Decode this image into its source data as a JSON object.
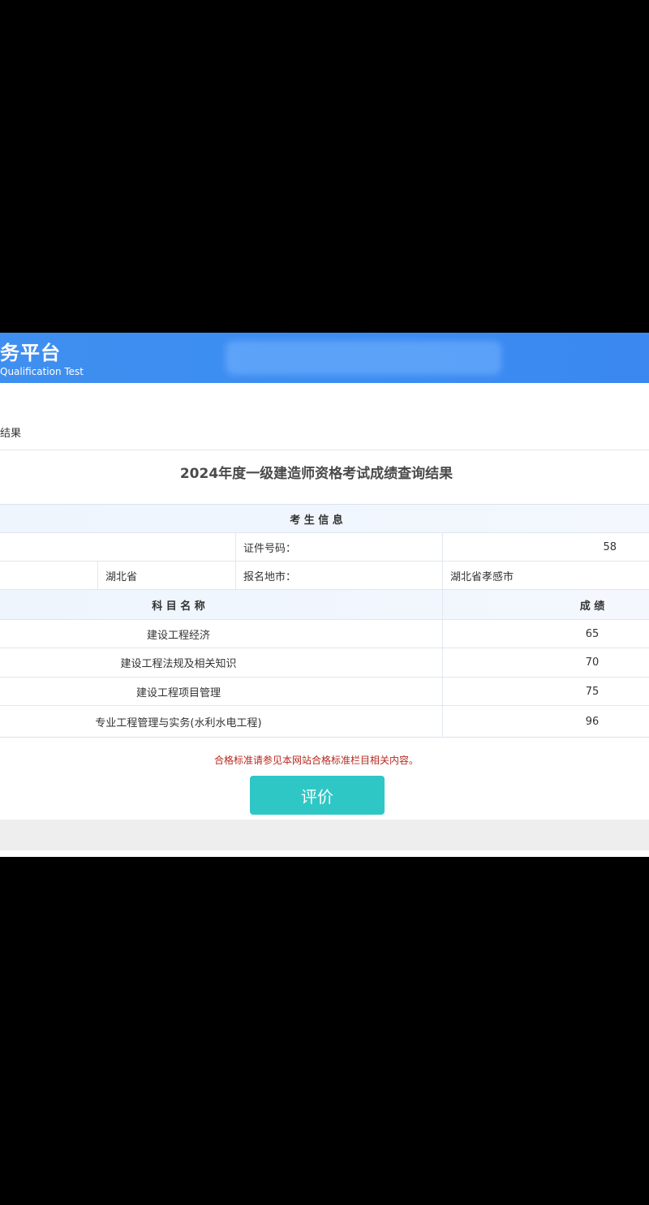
{
  "header": {
    "title": "务平台",
    "subtitle": "Qualification Test"
  },
  "breadcrumb": "结果",
  "result_title": "2024年度一级建造师资格考试成绩查询结果",
  "candidate_info": {
    "section_label": "考 生 信 息",
    "id_label": "证件号码：",
    "id_value": "58",
    "province_value": "湖北省",
    "city_label": "报名地市：",
    "city_value": "湖北省孝感市"
  },
  "scores_table": {
    "columns": [
      "科 目 名 称",
      "成 绩"
    ],
    "rows": [
      {
        "subject": "建设工程经济",
        "score": "65"
      },
      {
        "subject": "建设工程法规及相关知识",
        "score": "70"
      },
      {
        "subject": "建设工程项目管理",
        "score": "75"
      },
      {
        "subject": "专业工程管理与实务(水利水电工程)",
        "score": "96"
      }
    ]
  },
  "notice": "合格标准请参见本网站合格标准栏目相关内容。",
  "evaluate_button": "评价",
  "colors": {
    "header_blue": "#3f8ff0",
    "button_teal": "#2fc7c5",
    "notice_red": "#b7281f"
  }
}
